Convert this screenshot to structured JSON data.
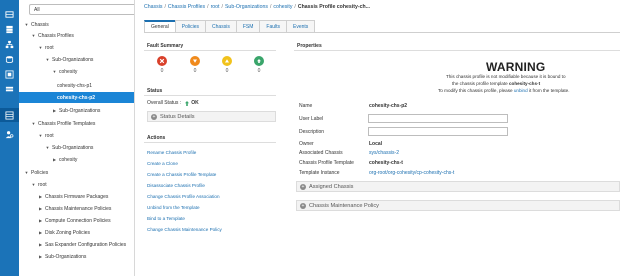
{
  "nav": {
    "filter": {
      "value": "All"
    },
    "tree": [
      {
        "label": "Chassis",
        "toggle": "▼"
      },
      {
        "label": "Chassis Profiles",
        "toggle": "▼"
      },
      {
        "label": "root",
        "toggle": "▼"
      },
      {
        "label": "Sub-Organizations",
        "toggle": "▼"
      },
      {
        "label": "cohesity",
        "toggle": "▼"
      },
      {
        "label": "cohesity-chs-p1",
        "toggle": ""
      },
      {
        "label": "cohesity-chs-p2",
        "toggle": ""
      },
      {
        "label": "Sub-Organizations",
        "toggle": "▶"
      },
      {
        "label": "Chassis Profile Templates",
        "toggle": "▼"
      },
      {
        "label": "root",
        "toggle": "▼"
      },
      {
        "label": "Sub-Organizations",
        "toggle": "▼"
      },
      {
        "label": "cohesity",
        "toggle": "▶"
      },
      {
        "label": "Policies",
        "toggle": "▼"
      },
      {
        "label": "root",
        "toggle": "▼"
      },
      {
        "label": "Chassis Firmware Packages",
        "toggle": "▶"
      },
      {
        "label": "Chassis Maintenance Policies",
        "toggle": "▶"
      },
      {
        "label": "Compute Connection Policies",
        "toggle": "▶"
      },
      {
        "label": "Disk Zoning Policies",
        "toggle": "▶"
      },
      {
        "label": "Sas Expander Configuration Policies",
        "toggle": "▶"
      },
      {
        "label": "Sub-Organizations",
        "toggle": "▶"
      }
    ]
  },
  "breadcrumb": {
    "items": [
      "Chassis",
      "Chassis Profiles",
      "root",
      "Sub-Organizations",
      "cohesity"
    ],
    "separator": "/",
    "current": "Chassis Profile cohesity-ch..."
  },
  "tabs": [
    "General",
    "Policies",
    "Chassis",
    "FSM",
    "Faults",
    "Events"
  ],
  "fault_summary": {
    "title": "Fault Summary",
    "counts": [
      "0",
      "0",
      "0",
      "0"
    ],
    "colors": [
      "#d9412b",
      "#f08a1c",
      "#f1c21b",
      "#3aa56b"
    ]
  },
  "status": {
    "title": "Status",
    "overall_label": "Overall Status :",
    "overall_value": "OK",
    "details_label": "Status Details"
  },
  "actions": {
    "title": "Actions",
    "items": [
      "Rename Chassis Profile",
      "Create a Clone",
      "Create a Chassis Profile Template",
      "Disassociate Chassis Profile",
      "Change Chassis Profile Association",
      "Unbind from the Template",
      "Bind to a Template",
      "Change Chassis Maintenance Policy"
    ]
  },
  "properties": {
    "title": "Properties",
    "warning_title": "WARNING",
    "warning_line1": "This chassis profile is not modifiable because it is bound to",
    "warning_line2_prefix": "the chassis profile template ",
    "warning_line2_name": "cohesity-chs-t",
    "warning_line3_prefix": "To modify this chassis profile, please ",
    "warning_line3_link": "unbind",
    "warning_line3_suffix": " it from the template.",
    "name_label": "Name",
    "name_value": "cohesity-chs-p2",
    "user_label_label": "User Label",
    "user_label_value": "",
    "description_label": "Description",
    "description_value": "",
    "owner_label": "Owner",
    "owner_value": "Local",
    "assoc_label": "Associated Chassis",
    "assoc_value": "sys/chassis-2",
    "template_label": "Chassis Profile Template",
    "template_value": "cohesity-chs-t",
    "instance_label": "Template Instance",
    "instance_value": "org-root/org-cohesity/cp-cohesity-chs-t",
    "assigned_chassis_label": "Assigned Chassis",
    "maint_policy_label": "Chassis Maintenance Policy"
  }
}
